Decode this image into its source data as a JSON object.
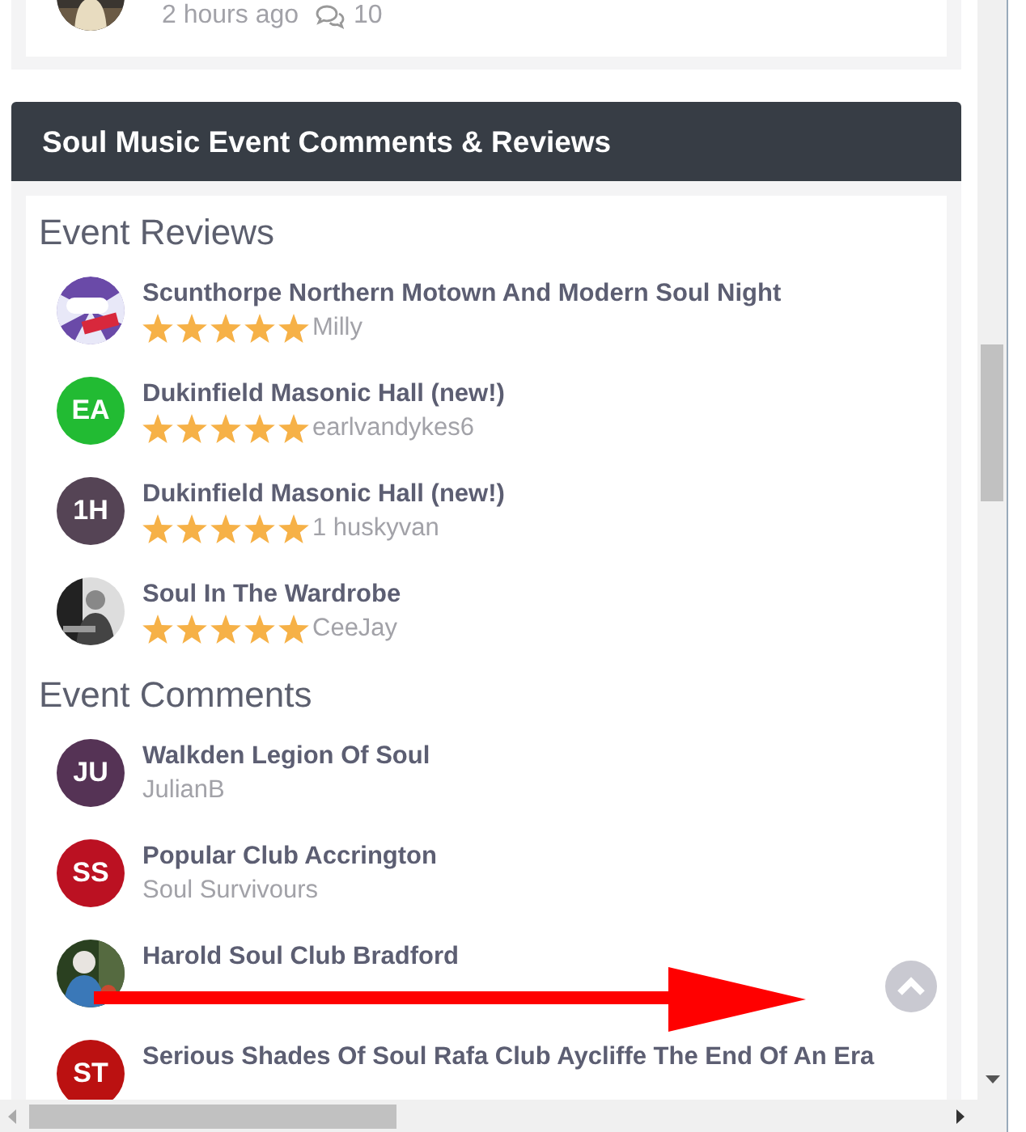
{
  "recent_post": {
    "time": "2 hours ago",
    "comments": "10"
  },
  "panel": {
    "title": "Soul Music Event Comments & Reviews"
  },
  "reviews": {
    "heading": "Event Reviews",
    "items": [
      {
        "title": "Scunthorpe Northern Motown And Modern Soul Night",
        "stars": 5,
        "author": "Milly",
        "avatar": {
          "kind": "logo"
        }
      },
      {
        "title": "Dukinfield Masonic Hall (new!)",
        "stars": 5,
        "author": "earlvandykes6",
        "avatar": {
          "kind": "initials",
          "initials": "EA",
          "color": "#22bb33"
        }
      },
      {
        "title": "Dukinfield Masonic Hall (new!)",
        "stars": 5,
        "author": "1 huskyvan",
        "avatar": {
          "kind": "initials",
          "initials": "1H",
          "color": "#554455"
        }
      },
      {
        "title": "Soul In The Wardrobe",
        "stars": 5,
        "author": "CeeJay"
      }
    ]
  },
  "comments": {
    "heading": "Event Comments",
    "items": [
      {
        "title": "Walkden Legion Of Soul",
        "author": "JulianB",
        "avatar": {
          "kind": "initials",
          "initials": "JU",
          "color": "#553355"
        }
      },
      {
        "title": "Popular Club Accrington",
        "author": "Soul Survivours",
        "avatar": {
          "kind": "initials",
          "initials": "SS",
          "color": "#bb1122"
        }
      },
      {
        "title": "Harold Soul Club Bradford"
      },
      {
        "title": "Serious Shades Of Soul Rafa Club Aycliffe The End Of An Era",
        "avatar": {
          "kind": "initials",
          "initials": "ST",
          "color": "#bb1111"
        }
      }
    ]
  }
}
